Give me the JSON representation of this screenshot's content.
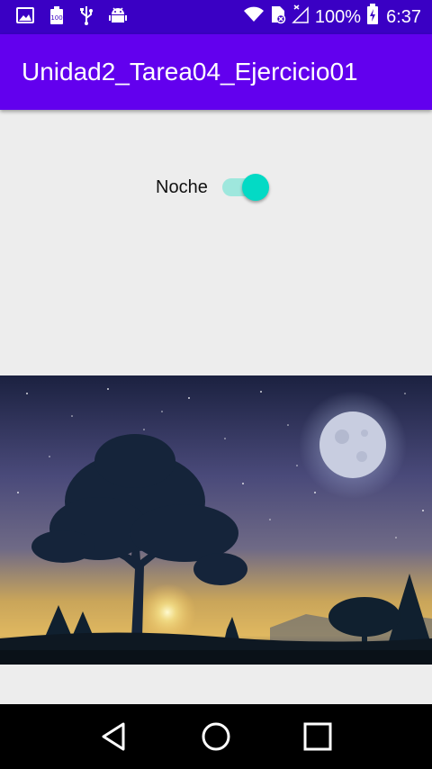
{
  "status_bar": {
    "battery_percent": "100%",
    "time": "6:37",
    "icons": [
      "image-icon",
      "battery-saver-icon",
      "usb-icon",
      "android-debug-icon",
      "wifi-icon",
      "no-sim-icon",
      "signal-icon",
      "battery-charging-icon"
    ]
  },
  "app_bar": {
    "title": "Unidad2_Tarea04_Ejercicio01",
    "color": "#6200ee"
  },
  "switch": {
    "label": "Noche",
    "checked": true,
    "accent_color": "#03dac5"
  },
  "image": {
    "subject": "night-landscape"
  },
  "nav_bar": {
    "buttons": [
      "back-icon",
      "home-icon",
      "recents-icon"
    ]
  }
}
